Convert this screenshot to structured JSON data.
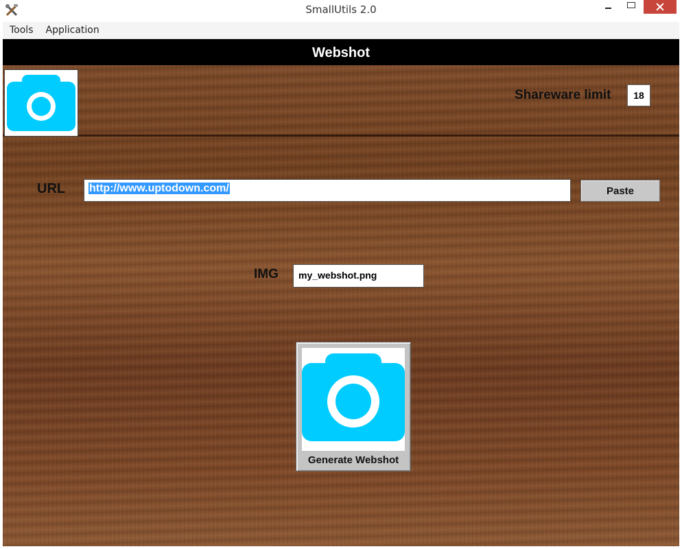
{
  "window": {
    "title": "SmallUtils 2.0"
  },
  "menu": {
    "items": [
      "Tools",
      "Application"
    ]
  },
  "header": {
    "title": "Webshot"
  },
  "shareware": {
    "label": "Shareware limit",
    "count": "18"
  },
  "url": {
    "label": "URL",
    "value": "http://www.uptodown.com/"
  },
  "paste": {
    "label": "Paste"
  },
  "img": {
    "label": "IMG",
    "value": "my_webshot.png"
  },
  "generate": {
    "label": "Generate Webshot"
  },
  "icons": {
    "logo": "camera-icon",
    "generate": "camera-icon",
    "app": "tools-icon"
  },
  "colors": {
    "camera": "#00ccff",
    "header_bg": "#000000",
    "selection": "#3399ff",
    "close_button": "#c7453a"
  }
}
